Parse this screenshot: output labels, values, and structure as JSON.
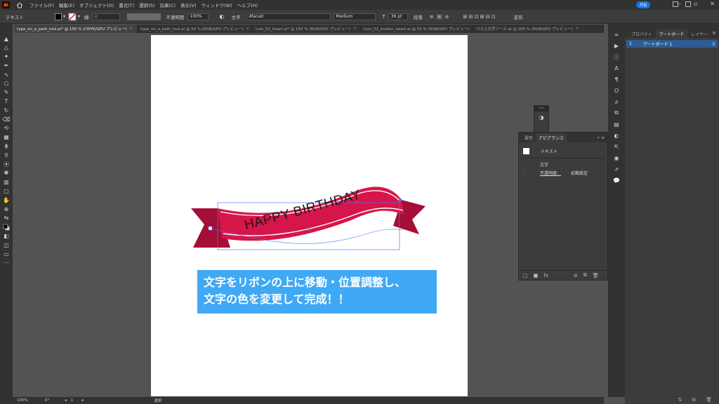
{
  "app": {
    "logo": "Ai"
  },
  "menu": [
    "ファイル(F)",
    "編集(E)",
    "オブジェクト(O)",
    "書式(T)",
    "選択(S)",
    "効果(C)",
    "表示(V)",
    "ウィンドウ(W)",
    "ヘルプ(H)"
  ],
  "share_label": "共有",
  "control_bar": {
    "selection_label": "テキスト",
    "stroke_label": "線",
    "opacity_label": "不透明度",
    "opacity_value": "100%",
    "char_label": "文字",
    "font_family": "Afacad",
    "font_style": "Medium",
    "font_size": "36 pt",
    "paragraph_label": "段落",
    "transform_label": "変形"
  },
  "tabs": [
    {
      "label": "type_on_a_path_tool.ai* @ 100 % (CMYK/GPU プレビュー)",
      "active": true
    },
    {
      "label": "type_on_a_path_tool.ai @ 50 % (RGB/GPU プレビュー)",
      "active": false
    },
    {
      "label": "icon_01_heart.ai* @ 150 % (RGB/GPU プレビュー)",
      "active": false
    },
    {
      "label": "icon_02_broken_heart.ai @ 50 % (RGB/GPU プレビュー)",
      "active": false
    },
    {
      "label": "パス上文字ツール.ai @ 200 % (RGB/GPU プレビュー)",
      "active": false
    }
  ],
  "artwork": {
    "ribbon_text": "HAPPY BIRTHDAY",
    "caption_lines": [
      "文字をリボンの上に移動・位置調整し、",
      "文字の色を変更して完成！！"
    ],
    "ribbon_color": "#d6154a",
    "ribbon_dark": "#a50e36",
    "caption_bg": "#3fa9f5"
  },
  "right_panel": {
    "tabs": [
      "プロパティ",
      "アートボード",
      "レイヤー"
    ],
    "active_tab": "アートボード",
    "artboard_row": {
      "index": "1",
      "name": "アートボード 1"
    }
  },
  "appearance_panel": {
    "tabs": [
      "属性",
      "アピアランス"
    ],
    "active_tab": "アピアランス",
    "object_label": "テキスト",
    "char_label": "文字",
    "opacity_label": "不透明度：",
    "opacity_value": "初期設定"
  },
  "status_bar": {
    "zoom": "100%",
    "rotation": "0°",
    "page": "1",
    "tool": "選択"
  }
}
